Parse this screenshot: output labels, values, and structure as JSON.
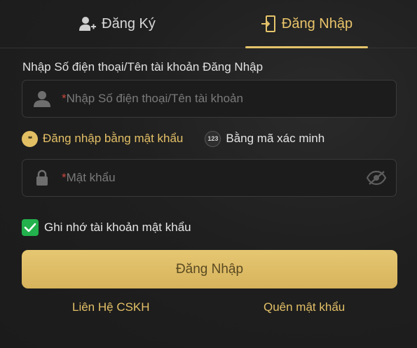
{
  "tabs": {
    "register": {
      "label": "Đăng Ký",
      "icon": "add-user-icon"
    },
    "login": {
      "label": "Đăng Nhập",
      "icon": "door-login-icon",
      "active": true
    }
  },
  "form": {
    "username_label": "Nhập Số điện thoại/Tên tài khoản Đăng Nhập",
    "username_placeholder": "Nhập Số điện thoại/Tên tài khoản",
    "required_mark": "*",
    "password_placeholder": "Mật khẩu"
  },
  "login_modes": {
    "password": {
      "label": "Đăng nhập bằng mật khẩu",
      "icon_text": "**",
      "selected": true
    },
    "code": {
      "label": "Bằng mã xác minh",
      "icon_text": "123",
      "selected": false
    }
  },
  "remember": {
    "label": "Ghi nhớ tài khoản mật khẩu",
    "checked": true
  },
  "login_button": {
    "label": "Đăng Nhập"
  },
  "links": {
    "support": "Liên Hệ CSKH",
    "forgot_password": "Quên mật khẩu"
  },
  "colors": {
    "accent": "#e5c46a",
    "background": "#1f1f1f",
    "checkbox": "#22b14c",
    "required": "#c8483d"
  }
}
